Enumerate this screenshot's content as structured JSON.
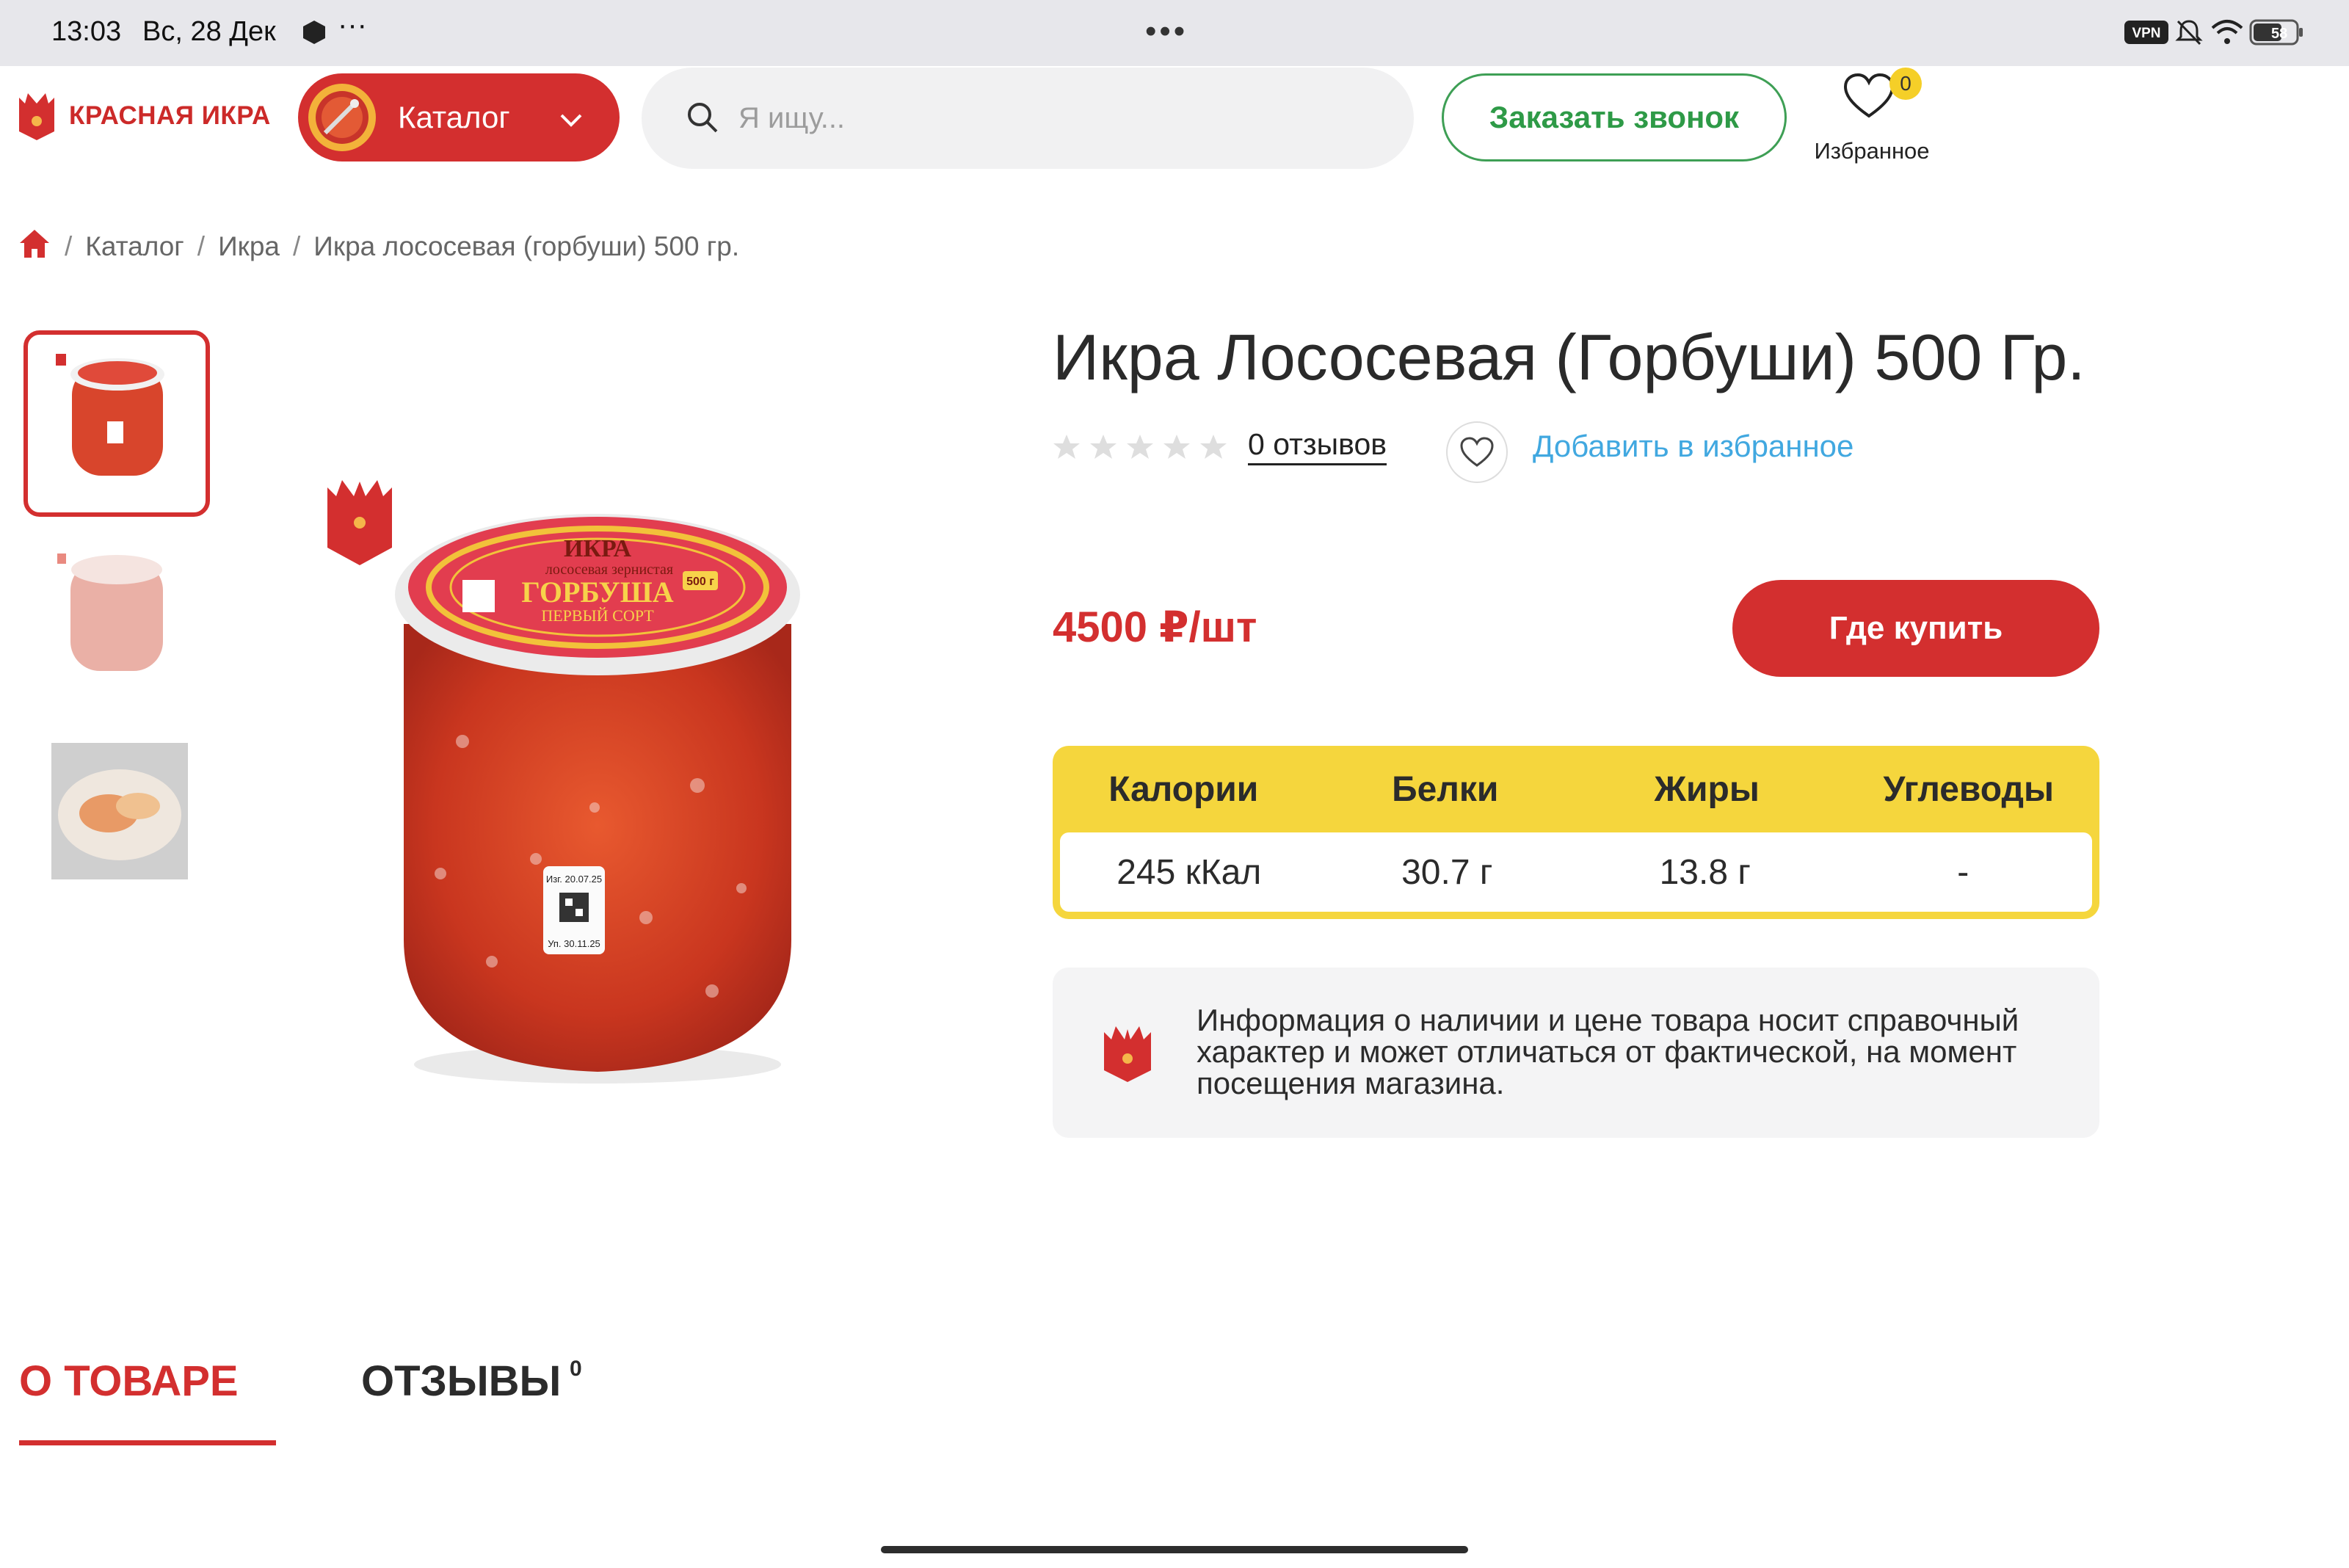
{
  "status_bar": {
    "time": "13:03",
    "date": "Вс, 28 Дек",
    "more": "•••",
    "vpn": "VPN",
    "battery": "58"
  },
  "header": {
    "logo_text": "КРАСНАЯ ИКРА",
    "catalog_label": "Каталог",
    "search_placeholder": "Я ищу...",
    "callback_label": "Заказать звонок",
    "favorites_label": "Избранное",
    "favorites_count": "0"
  },
  "breadcrumb": {
    "sep": "/",
    "items": [
      "Каталог",
      "Икра",
      "Икра лососевая (горбуши) 500 гр."
    ]
  },
  "gallery": {
    "logo_badge": "КРАСНАЯ ИКРА"
  },
  "product": {
    "title": "Икра Лососевая (Горбуши) 500 Гр.",
    "rating": 0,
    "reviews_link": "0 отзывов",
    "add_favorite": "Добавить в избранное",
    "price": "4500 ₽/шт",
    "buy_label": "Где купить"
  },
  "jar_label": {
    "t1": "ИКРА",
    "t2": "лососевая зернистая",
    "t3": "ГОРБУША",
    "t4": "ПЕРВЫЙ СОРТ",
    "weight": "500 г"
  },
  "sticker": {
    "made": "Изг. 20.07.25",
    "packed": "Уп. 30.11.25"
  },
  "nutrition": {
    "headers": [
      "Калории",
      "Белки",
      "Жиры",
      "Углеводы"
    ],
    "values": [
      "245 кКал",
      "30.7 г",
      "13.8 г",
      "-"
    ]
  },
  "info": {
    "text": "Информация о наличии и цене товара носит справочный характер и может отличаться от фактической, на момент посещения магазина."
  },
  "tabs": {
    "about": "О ТОВАРЕ",
    "reviews": "ОТЗЫВЫ",
    "reviews_count": "0"
  },
  "colors": {
    "accent": "#d32f2f",
    "yellow": "#f5d63d",
    "green": "#2e9a47",
    "link": "#41a8e0"
  }
}
